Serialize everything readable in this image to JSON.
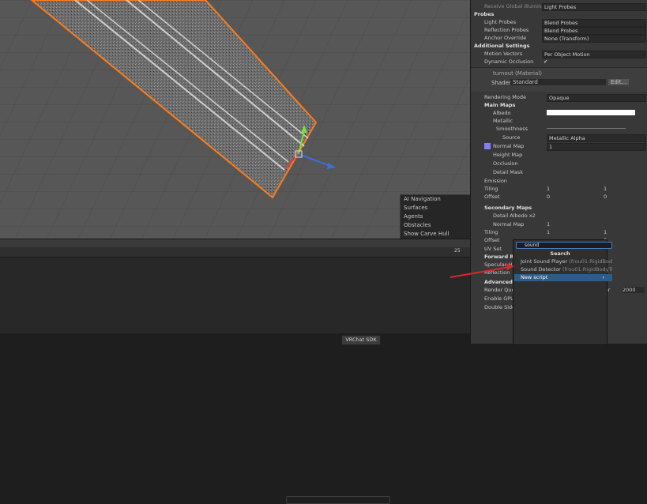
{
  "nav_overlay": {
    "title": "AI Navigation",
    "items": [
      "Surfaces",
      "Agents",
      "Obstacles"
    ],
    "option": "Show Carve Hull"
  },
  "scene_toolbar": {
    "layer_count": "25"
  },
  "inspector": {
    "receive_gi": {
      "label": "Receive Global Illuminatio",
      "value": "Light Probes"
    },
    "probes": {
      "header": "Probes",
      "light_probes": {
        "label": "Light Probes",
        "value": "Blend Probes"
      },
      "reflection_probes": {
        "label": "Reflection Probes",
        "value": "Blend Probes"
      },
      "anchor": {
        "label": "Anchor Override",
        "value": "None (Transform)"
      }
    },
    "additional": {
      "header": "Additional Settings",
      "motion": {
        "label": "Motion Vectors",
        "value": "Per Object Motion"
      },
      "occlusion": {
        "label": "Dynamic Occlusion",
        "value": "✔"
      }
    },
    "material": {
      "name": "turnout (Material)",
      "shader_label": "Shader",
      "shader_value": "Standard",
      "edit": "Edit..."
    },
    "rendering_mode": {
      "label": "Rendering Mode",
      "value": "Opaque"
    },
    "main_maps": "Main Maps",
    "albedo": "Albedo",
    "metallic": "Metallic",
    "smoothness": "Smoothness",
    "source": {
      "label": "Source",
      "value": "Metallic Alpha"
    },
    "normal_map": {
      "label": "Normal Map",
      "value": "1"
    },
    "height_map": "Height Map",
    "occlusion_map": "Occlusion",
    "detail_mask": "Detail Mask",
    "emission": "Emission",
    "tiling": {
      "label": "Tiling",
      "x": "1",
      "y": "1"
    },
    "offset": {
      "label": "Offset",
      "x": "0",
      "y": "0"
    },
    "secondary": "Secondary Maps",
    "detail_albedo": "Detail Albedo x2",
    "normal_map2": {
      "label": "Normal Map",
      "value": "1"
    },
    "tiling2": {
      "label": "Tiling",
      "x": "1",
      "y": "1"
    },
    "offset2": {
      "label": "Offset",
      "y": "0"
    },
    "uv_set": "UV Set",
    "forward": "Forward Ren",
    "specular": "Specular Hig",
    "reflections": "Reflection",
    "advanced": "Advanced Op",
    "render_queue": {
      "label": "Render Queu",
      "mode": "ler",
      "value": "2000"
    },
    "gpu": "Enable GPU I",
    "double_sided": "Double Sided"
  },
  "add_component": {
    "search_value": "sound",
    "title": "Search",
    "items": [
      {
        "name": "Joint Sound Player",
        "path": "(frou01.RigidBody"
      },
      {
        "name": "Sound Detector",
        "path": "(frou01.RigidBodyTra"
      },
      {
        "name": "New script",
        "path": ""
      }
    ],
    "arrow": "›"
  },
  "status": {
    "vrchat_sdk": "VRChat SDK"
  }
}
